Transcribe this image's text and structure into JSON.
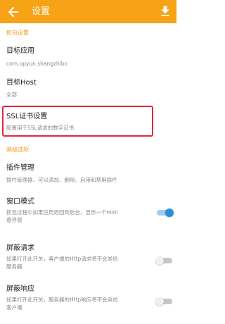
{
  "appbar": {
    "title": "设置",
    "back_icon": "arrow-left-icon",
    "action_icon": "download-icon",
    "color": "#f6a315"
  },
  "sections": {
    "capture": "抓包设置",
    "advanced": "高级选项"
  },
  "items": {
    "target_app": {
      "title": "目标应用",
      "subtitle": "com.upyun.shangzhibo"
    },
    "target_host": {
      "title": "目标Host",
      "subtitle": "全部"
    },
    "ssl": {
      "title": "SSL证书设置",
      "subtitle": "配置用于SSL请求的数字证书"
    },
    "plugins": {
      "title": "插件管理",
      "subtitle": "插件管理器，可以添加、删除、启用和禁用插件"
    },
    "window_mode": {
      "title": "窗口模式",
      "subtitle_line1": "抓包过程中如果应用退回到后台，显示一个mini",
      "subtitle_line2": "悬浮窗",
      "toggle_on": true
    },
    "block_request": {
      "title": "屏蔽请求",
      "subtitle_line1": "如果打开此开关，客户端的Http请求将不会发给",
      "subtitle_line2": "服务器",
      "toggle_on": false
    },
    "block_response": {
      "title": "屏蔽响应",
      "subtitle_line1": "如果打开此开关，服务器的Http响应将不会返给",
      "subtitle_line2": "客户端",
      "toggle_on": false
    }
  },
  "colors": {
    "accent": "#f39a1a",
    "highlight_border": "#e8263a",
    "toggle_on": "#2a8fd8"
  }
}
